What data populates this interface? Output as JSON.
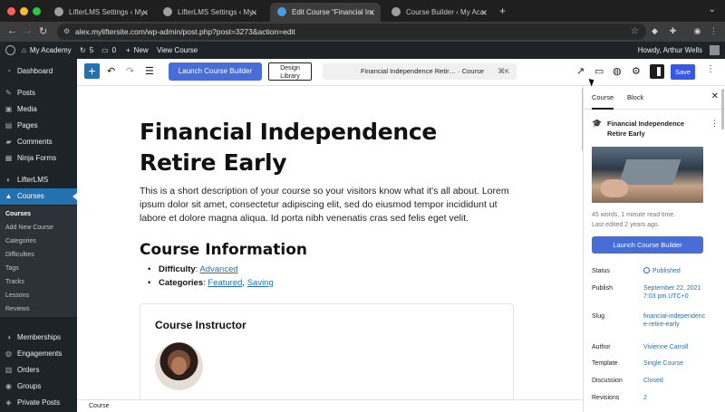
{
  "browser": {
    "tabs": [
      {
        "title": "LifterLMS Settings ‹ My Acad"
      },
      {
        "title": "LifterLMS Settings ‹ My Acad"
      },
      {
        "title": "Edit Course “Financial Indep"
      },
      {
        "title": "Course Builder ‹ My Academ"
      }
    ],
    "url": "alex.myliftersite.com/wp-admin/post.php?post=3273&action=edit"
  },
  "adminbar": {
    "site": "My Academy",
    "updates": "5",
    "comments": "0",
    "new": "New",
    "view": "View Course",
    "greeting": "Howdy, Arthur Wells"
  },
  "menu": {
    "items": [
      {
        "label": "Dashboard",
        "icon": "dashboard-icon",
        "glyph": "◔"
      },
      {
        "label": "Posts",
        "icon": "pin-icon",
        "glyph": "✎"
      },
      {
        "label": "Media",
        "icon": "media-icon",
        "glyph": "▣"
      },
      {
        "label": "Pages",
        "icon": "page-icon",
        "glyph": "▤"
      },
      {
        "label": "Comments",
        "icon": "comment-icon",
        "glyph": "▰"
      },
      {
        "label": "Ninja Forms",
        "icon": "forms-icon",
        "glyph": "▦"
      },
      {
        "label": "LifterLMS",
        "icon": "lifterlms-icon",
        "glyph": "◐"
      },
      {
        "label": "Courses",
        "icon": "graduation-cap-icon",
        "glyph": "▲"
      },
      {
        "label": "Memberships",
        "icon": "memberships-icon",
        "glyph": "◑"
      },
      {
        "label": "Engagements",
        "icon": "engagements-icon",
        "glyph": "◍"
      },
      {
        "label": "Orders",
        "icon": "cart-icon",
        "glyph": "▥"
      },
      {
        "label": "Groups",
        "icon": "groups-icon",
        "glyph": "◉"
      },
      {
        "label": "Private Posts",
        "icon": "private-icon",
        "glyph": "◈"
      }
    ],
    "submenu": [
      "Courses",
      "Add New Course",
      "Categories",
      "Difficulties",
      "Tags",
      "Tracks",
      "Lessons",
      "Reviews"
    ]
  },
  "toolbar": {
    "launch_builder": "Launch Course Builder",
    "design_library_1": "Design",
    "design_library_2": "Library",
    "command_title": "Financial Independence Retir…",
    "command_type": "· Course",
    "command_shortcut": "⌘K",
    "save": "Save"
  },
  "content": {
    "title": "Financial Independence Retire Early",
    "description": "This is a short description of your course so your visitors know what it's all about. Lorem ipsum dolor sit amet, consectetur adipiscing elit, sed do eiusmod tempor incididunt ut labore et dolore magna aliqua. Id porta nibh venenatis cras sed felis eget velit.",
    "info_heading": "Course Information",
    "difficulty_label": "Difficulty",
    "difficulty_value": "Advanced",
    "categories_label": "Categories",
    "category_1": "Featured",
    "category_2": "Saving",
    "instructor_heading": "Course Instructor"
  },
  "footer": {
    "breadcrumb": "Course"
  },
  "sidebar": {
    "tab_course": "Course",
    "tab_block": "Block",
    "course_name": "Financial Independence Retire Early",
    "words": "45 words, 1 minute read time.",
    "last_edited": "Last edited 2 years ago.",
    "launch_builder": "Launch Course Builder",
    "rows": [
      {
        "label": "Status",
        "value": "Published"
      },
      {
        "label": "Publish",
        "value": "September 22, 2021 7:03 pm UTC+0"
      },
      {
        "label": "Slug",
        "value": "financial-independence-retire-early"
      },
      {
        "label": "Author",
        "value": "Vivienne Carroll"
      },
      {
        "label": "Template",
        "value": "Single Course"
      },
      {
        "label": "Discussion",
        "value": "Closed"
      },
      {
        "label": "Revisions",
        "value": "2"
      }
    ]
  },
  "colors": {
    "wp_blue": "#2271b1",
    "builder_blue": "#466dd8",
    "save_blue": "#3858e9",
    "admin_dark": "#1d2327"
  }
}
